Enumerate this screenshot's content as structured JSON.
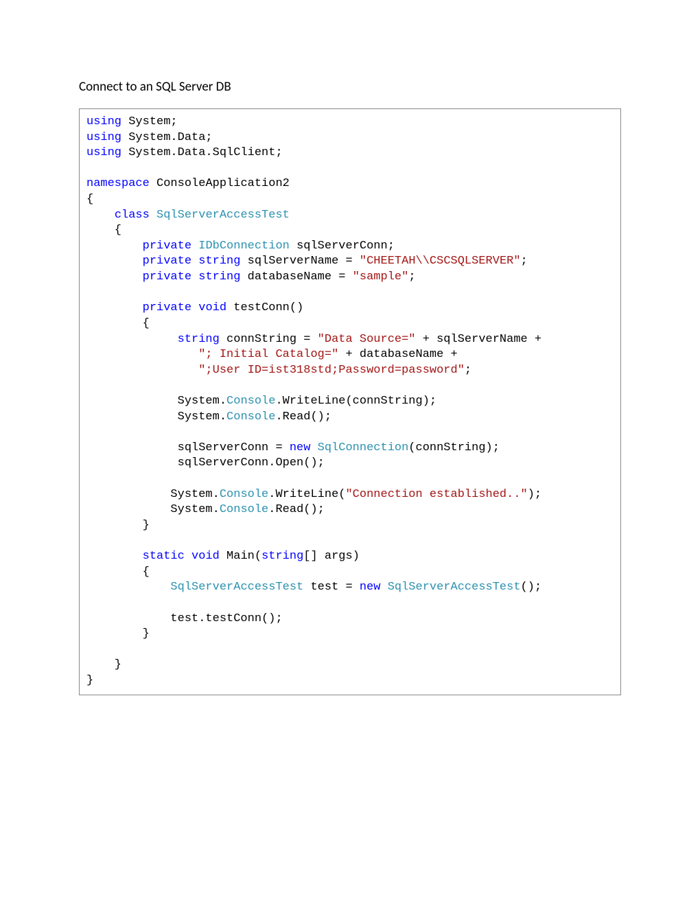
{
  "title": "Connect to an SQL Server DB",
  "code": {
    "kw_using": "using",
    "ns_system": " System;",
    "ns_system_data": " System.Data;",
    "ns_system_data_sqlclient": " System.Data.SqlClient;",
    "kw_namespace": "namespace",
    "ns_name": " ConsoleApplication2",
    "brace_open": "{",
    "indent1": "    ",
    "kw_class": "class",
    "sp": " ",
    "typ_class": "SqlServerAccessTest",
    "brace_open2": "    {",
    "indent2": "        ",
    "kw_private": "private",
    "typ_idb": "IDbConnection",
    "fld_conn": " sqlServerConn;",
    "kw_string": "string",
    "fld_srv_pre": " sqlServerName = ",
    "str_srv": "\"CHEETAH\\\\CSCSQLSERVER\"",
    "semicolon": ";",
    "fld_db_pre": " databaseName = ",
    "str_db": "\"sample\"",
    "kw_void": "void",
    "mtd_testconn": " testConn()",
    "brace_open3": "        {",
    "indent3a": "             ",
    "conn_pre": " connString = ",
    "str_ds": "\"Data Source=\"",
    "conn_mid1": " + sqlServerName +",
    "indent3b": "                ",
    "str_ic": "\"; Initial Catalog=\"",
    "conn_mid2": " + databaseName +",
    "str_uid": "\";User ID=ist318std;Password=password\"",
    "sys_pre": " System.",
    "typ_console": "Console",
    "wl_conn": ".WriteLine(connString);",
    "rd": ".Read();",
    "assign_conn": " sqlServerConn = ",
    "kw_new": "new",
    "typ_sqlconn": "SqlConnection",
    "sqlconn_args": "(connString);",
    "open_call": " sqlServerConn.Open();",
    "indent3c": "            System.",
    "wl_est_pre": ".WriteLine(",
    "str_est": "\"Connection established..\"",
    "wl_est_post": ");",
    "brace_close3": "        }",
    "kw_static": "static",
    "mtd_main": " Main(",
    "main_args": "[] args)",
    "indent3": "            ",
    "test_decl": " test = ",
    "ctor_call": "();",
    "test_call": "            test.testConn();",
    "brace_close2": "    }",
    "brace_close": "}"
  }
}
